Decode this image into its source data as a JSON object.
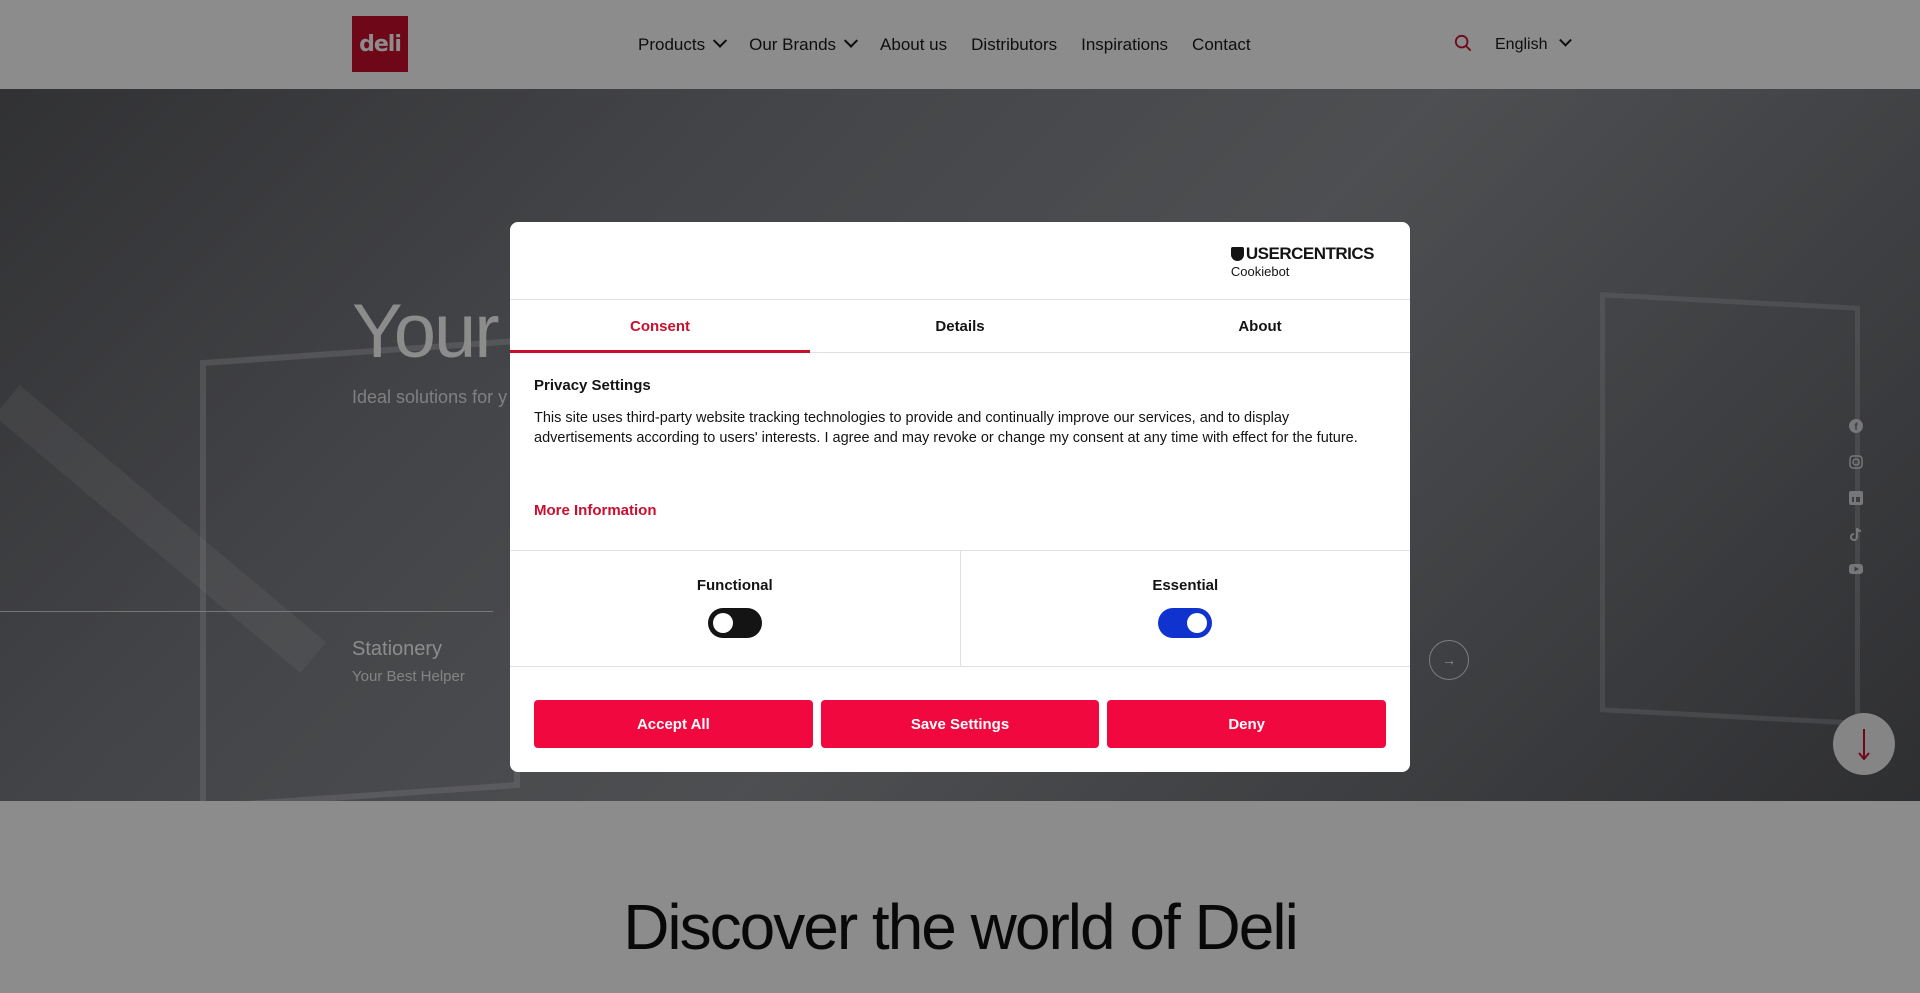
{
  "header": {
    "logo_text": "deli",
    "nav": [
      {
        "label": "Products",
        "has_dropdown": true
      },
      {
        "label": "Our Brands",
        "has_dropdown": true
      },
      {
        "label": "About us",
        "has_dropdown": false
      },
      {
        "label": "Distributors",
        "has_dropdown": false
      },
      {
        "label": "Inspirations",
        "has_dropdown": false
      },
      {
        "label": "Contact",
        "has_dropdown": false
      }
    ],
    "language": "English"
  },
  "hero": {
    "title": "Your o",
    "subtitle": "Ideal solutions for y",
    "slide_title": "Stationery",
    "slide_subtitle": "Your Best Helper",
    "social_icons": [
      "facebook-icon",
      "instagram-icon",
      "linkedin-icon",
      "tiktok-icon",
      "youtube-icon"
    ]
  },
  "discover_title": "Discover the world of Deli",
  "cookie_dialog": {
    "brand_line1": "USERCENTRICS",
    "brand_line2": "Cookiebot",
    "tabs": [
      {
        "label": "Consent",
        "active": true
      },
      {
        "label": "Details",
        "active": false
      },
      {
        "label": "About",
        "active": false
      }
    ],
    "privacy_title": "Privacy Settings",
    "privacy_text": "This site uses third-party website tracking technologies to provide and continually improve our services, and to display advertisements according to users' interests. I agree and may revoke or change my consent at any time with effect for the future.",
    "more_info": "More Information",
    "toggles": [
      {
        "label": "Functional",
        "checked": false
      },
      {
        "label": "Essential",
        "checked": true
      }
    ],
    "buttons": {
      "accept_all": "Accept All",
      "save_settings": "Save Settings",
      "deny": "Deny"
    }
  },
  "colors": {
    "brand_red": "#c8102e",
    "button_red": "#f0083f",
    "toggle_on": "#1032cf",
    "toggle_off": "#141414"
  }
}
